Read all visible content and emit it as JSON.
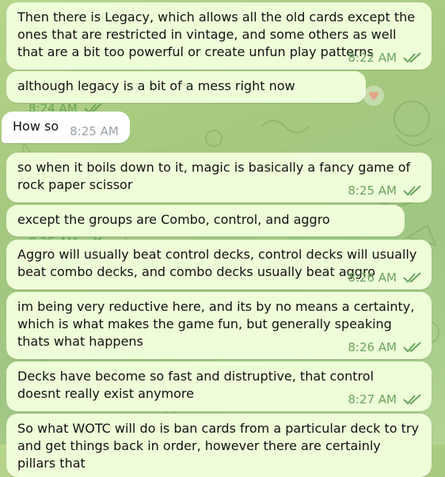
{
  "messages": [
    {
      "type": "out",
      "text": "Then there is Legacy, which allows all the old cards except the ones that are restricted in vintage, and some others as well that are a bit too powerful or create unfun play patterns",
      "time": "8:22 AM",
      "status": "read"
    },
    {
      "type": "out",
      "text": "although legacy is a bit of a mess right now",
      "time": "8:24 AM",
      "status": "read",
      "reaction": "heart"
    },
    {
      "type": "in",
      "text": "How so",
      "time": "8:25 AM"
    },
    {
      "type": "out",
      "text": "so when it boils down to it, magic is basically a fancy game of rock paper scissor",
      "time": "8:25 AM",
      "status": "read"
    },
    {
      "type": "out",
      "text": "except the groups are Combo, control, and aggro",
      "time": "8:25 AM",
      "status": "read"
    },
    {
      "type": "out",
      "text": "Aggro will usually beat control decks, control decks will usually beat combo decks, and combo decks usually beat aggro",
      "time": "8:26 AM",
      "status": "read"
    },
    {
      "type": "out",
      "text": "im being very reductive here, and its by no means a certainty, which is what makes the game fun, but generally speaking thats what happens",
      "time": "8:26 AM",
      "status": "read"
    },
    {
      "type": "out",
      "text": "Decks have become so fast and distruptive, that control doesnt really exist anymore",
      "time": "8:27 AM",
      "status": "read"
    },
    {
      "type": "out",
      "text": "So what WOTC will do is ban cards from a particular deck to try and get things back in order, however there are certainly pillars that",
      "time": "",
      "status": ""
    }
  ],
  "colors": {
    "outgoing_bubble": "#eefed9",
    "incoming_bubble": "#ffffff",
    "meta_green": "#6aa35c",
    "wallpaper": "#a5c97e"
  },
  "icons": {
    "read_status": "double-check-icon",
    "reaction": "heart-icon"
  }
}
